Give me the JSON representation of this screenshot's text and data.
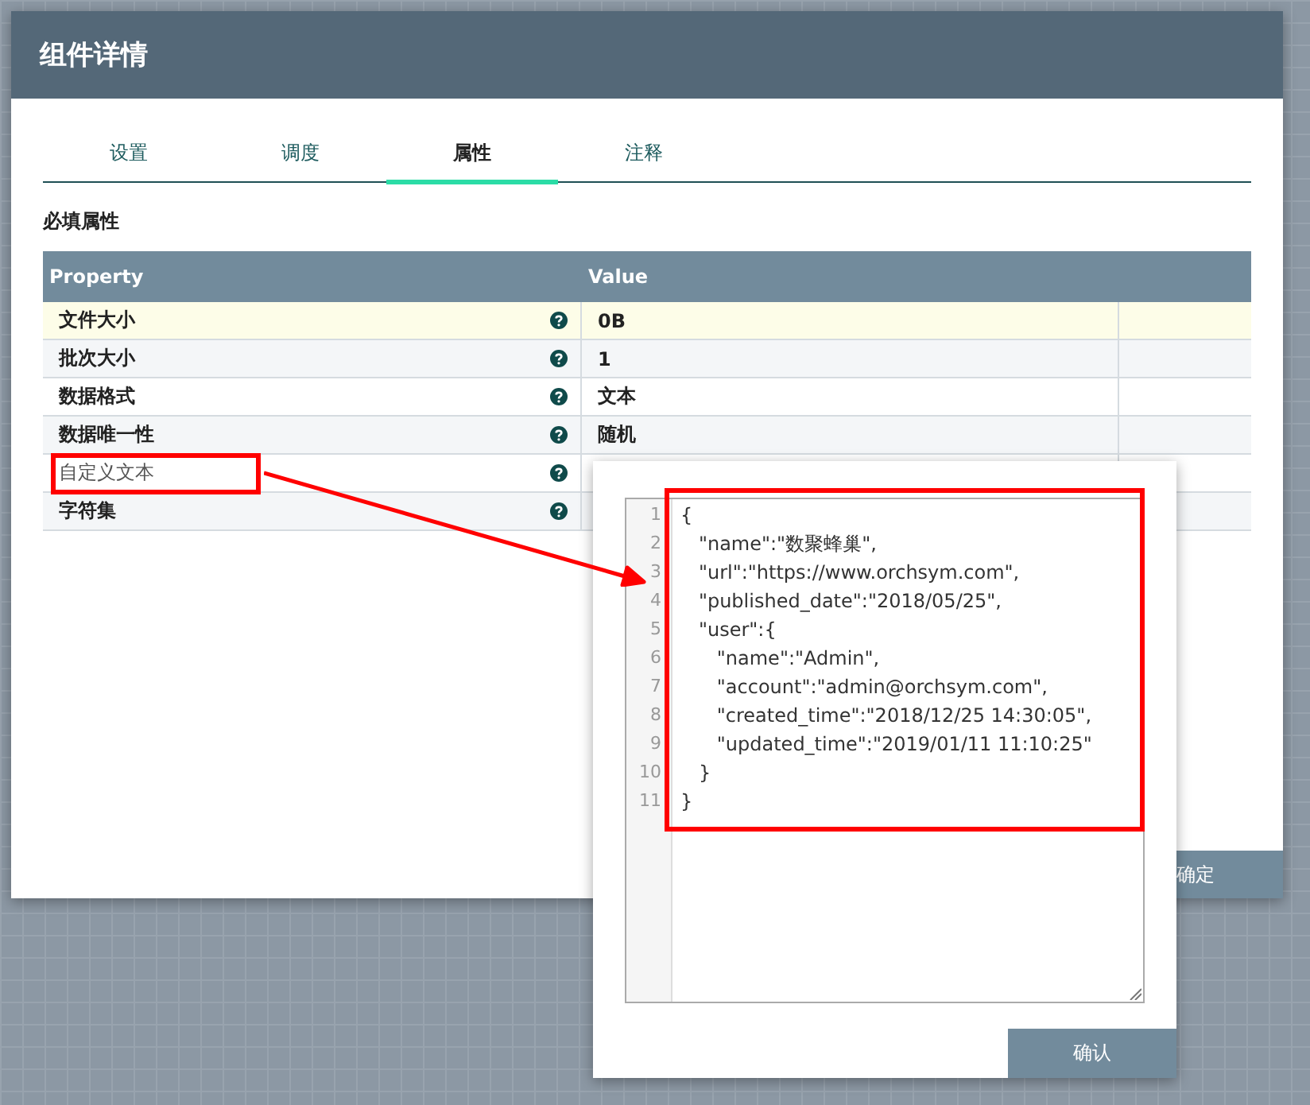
{
  "dialog": {
    "title": "组件详情",
    "tabs": [
      {
        "label": "设置",
        "selected": false
      },
      {
        "label": "调度",
        "selected": false
      },
      {
        "label": "属性",
        "selected": true
      },
      {
        "label": "注释",
        "selected": false
      }
    ],
    "section_title": "必填属性",
    "table": {
      "columns": [
        "Property",
        "Value"
      ],
      "rows": [
        {
          "property": "文件大小",
          "value": "0B",
          "selected": true,
          "editing": false
        },
        {
          "property": "批次大小",
          "value": "1",
          "selected": false,
          "editing": false
        },
        {
          "property": "数据格式",
          "value": "文本",
          "selected": false,
          "editing": false
        },
        {
          "property": "数据唯一性",
          "value": "随机",
          "selected": false,
          "editing": false
        },
        {
          "property": "自定义文本",
          "selected": false,
          "editing": true
        },
        {
          "property": "字符集",
          "selected": false,
          "editing": false
        }
      ]
    },
    "footer_button": "确定"
  },
  "editor_popup": {
    "lines": [
      {
        "number": "1",
        "text": "{"
      },
      {
        "number": "2",
        "text": "   \"name\":\"数聚蜂巢\","
      },
      {
        "number": "3",
        "text": "   \"url\":\"https://www.orchsym.com\","
      },
      {
        "number": "4",
        "text": "   \"published_date\":\"2018/05/25\","
      },
      {
        "number": "5",
        "text": "   \"user\":{"
      },
      {
        "number": "6",
        "text": "      \"name\":\"Admin\","
      },
      {
        "number": "7",
        "text": "      \"account\":\"admin@orchsym.com\","
      },
      {
        "number": "8",
        "text": "      \"created_time\":\"2018/12/25 14:30:05\","
      },
      {
        "number": "9",
        "text": "      \"updated_time\":\"2019/01/11 11:10:25\""
      },
      {
        "number": "10",
        "text": "   }"
      },
      {
        "number": "11",
        "text": "}"
      }
    ],
    "confirm_button": "确认"
  }
}
